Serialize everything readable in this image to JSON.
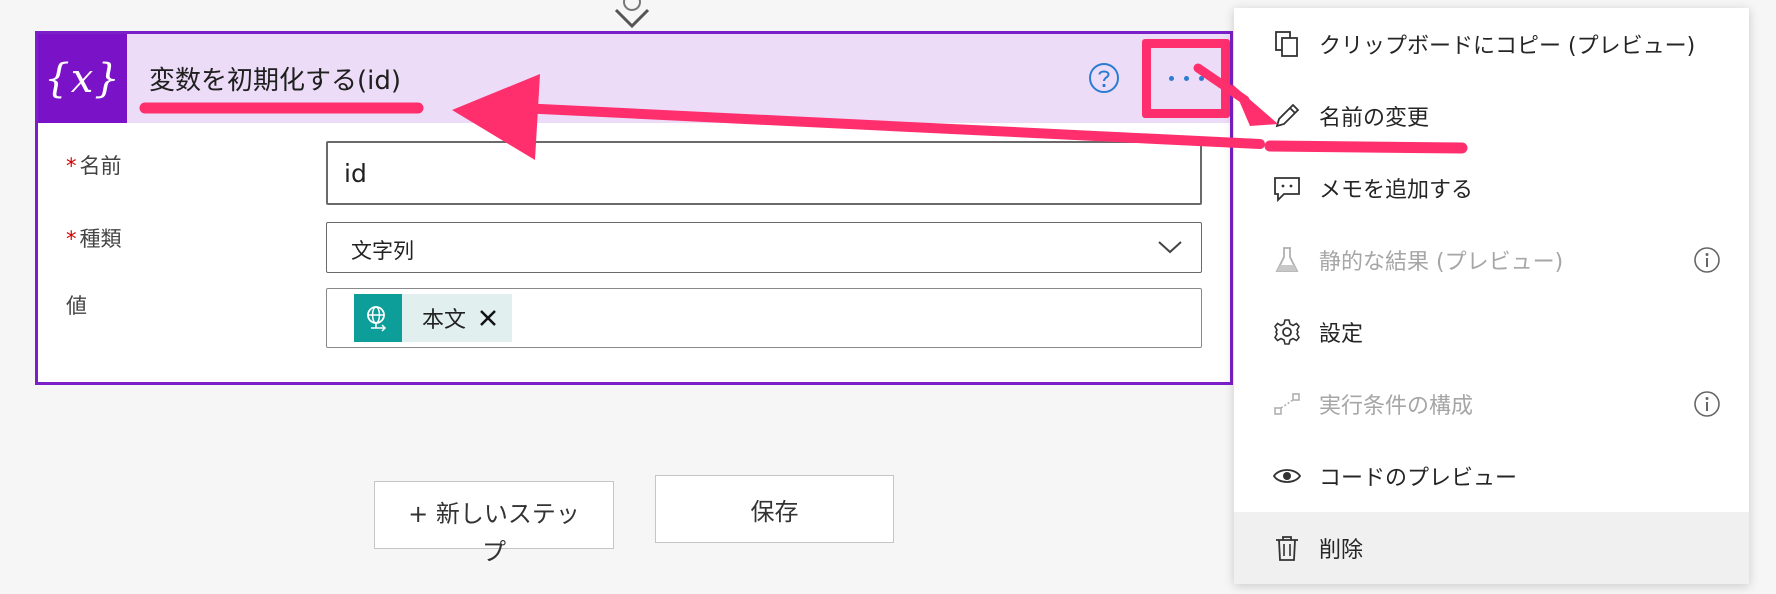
{
  "card": {
    "title": "変数を初期化する(id)",
    "icon_text": "{x}",
    "fields": {
      "name_label": "名前",
      "name_value": "id",
      "type_label": "種類",
      "type_value": "文字列",
      "value_label": "値",
      "token_label": "本文"
    },
    "required_marker": "*"
  },
  "buttons": {
    "new_step_line1": "+ 新しいステッ",
    "new_step_line2": "プ",
    "save": "保存"
  },
  "menu": {
    "items": [
      {
        "label": "クリップボードにコピー (プレビュー)",
        "icon": "copy-icon",
        "disabled": false
      },
      {
        "label": "名前の変更",
        "icon": "pencil-icon",
        "disabled": false
      },
      {
        "label": "メモを追加する",
        "icon": "comment-icon",
        "disabled": false
      },
      {
        "label": "静的な結果 (プレビュー)",
        "icon": "flask-icon",
        "disabled": true
      },
      {
        "label": "設定",
        "icon": "gear-icon",
        "disabled": false
      },
      {
        "label": "実行条件の構成",
        "icon": "run-after-icon",
        "disabled": true
      },
      {
        "label": "コードのプレビュー",
        "icon": "eye-icon",
        "disabled": false
      },
      {
        "label": "削除",
        "icon": "trash-icon",
        "disabled": false
      }
    ]
  },
  "colors": {
    "card_border": "#7b1fc9",
    "card_header": "#ecdcf7",
    "icon_bg": "#7a12c8",
    "annotation": "#ff2f6e",
    "token_icon": "#0e9e9a"
  }
}
